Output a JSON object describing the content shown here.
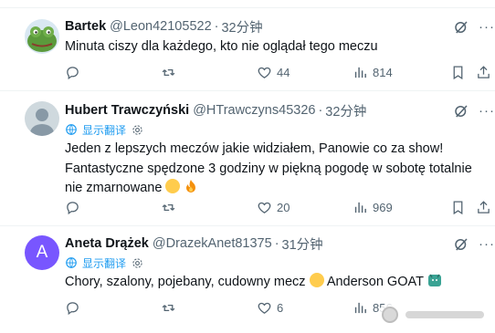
{
  "replies": [
    {
      "name": "Bartek",
      "handle": "@Leon42105522",
      "dot": "·",
      "time": "32分钟",
      "text": "Minuta ciszy dla każdego, kto nie oglądał tego meczu",
      "reply_count": "",
      "retweet_count": "",
      "like_count": "44",
      "view_count": "814"
    },
    {
      "name": "Hubert Trawczyński",
      "handle": "@HTrawczyns45326",
      "dot": "·",
      "time": "32分钟",
      "translate_label": "显示翻译",
      "text": "Jeden z lepszych meczów jakie widziałem, Panowie co za show! Fantastyczne spędzone 3 godziny w piękną pogodę w sobotę totalnie nie zmarnowane",
      "reply_count": "",
      "retweet_count": "",
      "like_count": "20",
      "view_count": "969"
    },
    {
      "name": "Aneta Drążek",
      "handle": "@DrazekAnet81375",
      "dot": "·",
      "time": "31分钟",
      "avatar_letter": "A",
      "translate_label": "显示翻译",
      "text": "Chory, szalony, pojebany, cudowny mecz",
      "text_tail": "Anderson GOAT",
      "reply_count": "",
      "retweet_count": "",
      "like_count": "6",
      "view_count": "856"
    }
  ],
  "icons": {
    "avatar_accent": "#7856ff",
    "link_color": "#1d9bf0",
    "muted": "#536471"
  }
}
